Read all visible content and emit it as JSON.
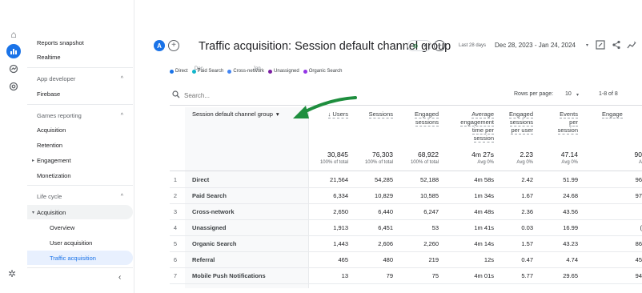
{
  "rail": {
    "icons": [
      "home-icon",
      "reports-icon",
      "explore-icon",
      "advertising-icon",
      "settings-icon"
    ]
  },
  "sidebar": {
    "reports_snapshot": "Reports snapshot",
    "realtime": "Realtime",
    "app_developer": "App developer",
    "firebase": "Firebase",
    "games_reporting": "Games reporting",
    "acquisition_games": "Acquisition",
    "retention": "Retention",
    "engagement": "Engagement",
    "monetization": "Monetization",
    "life_cycle": "Life cycle",
    "acquisition": "Acquisition",
    "overview": "Overview",
    "user_acquisition": "User acquisition",
    "traffic_acquisition": "Traffic acquisition",
    "collapse": "‹"
  },
  "header": {
    "badge": "A",
    "title": "Traffic acquisition: Session default channel group",
    "date_label": "Last 28 days",
    "date_range": "Dec 28, 2023 - Jan 24, 2024"
  },
  "chart_axis": {
    "tick1": "Dec",
    "tick2": "Jan"
  },
  "legend": [
    {
      "label": "Direct",
      "color": "#1a73e8"
    },
    {
      "label": "Paid Search",
      "color": "#12b5cb"
    },
    {
      "label": "Cross-network",
      "color": "#4285f4"
    },
    {
      "label": "Unassigned",
      "color": "#7b1fa2"
    },
    {
      "label": "Organic Search",
      "color": "#9334e6"
    }
  ],
  "table_controls": {
    "search_placeholder": "Search...",
    "rows_per_page_label": "Rows per page:",
    "rows_per_page": "10",
    "pager": "1-8 of 8"
  },
  "table": {
    "dimension_header": "Session default channel group",
    "columns": {
      "users": "↓ Users",
      "sessions": "Sessions",
      "engaged_sessions": [
        "Engaged",
        "sessions"
      ],
      "avg_engagement": [
        "Average",
        "engagement",
        "time per",
        "session"
      ],
      "engaged_per_user": [
        "Engaged",
        "sessions",
        "per user"
      ],
      "events_per_session": [
        "Events",
        "per",
        "session"
      ],
      "engagement_rate": "Engage"
    },
    "totals": {
      "users": "30,845",
      "users_sub": "100% of total",
      "sessions": "76,303",
      "sessions_sub": "100% of total",
      "engaged_sessions": "68,922",
      "engaged_sessions_sub": "100% of total",
      "avg_engagement": "4m 27s",
      "avg_engagement_sub": "Avg 0%",
      "engaged_per_user": "2.23",
      "engaged_per_user_sub": "Avg 0%",
      "events_per_session": "47.14",
      "events_per_session_sub": "Avg 0%",
      "engagement_rate": "90",
      "engagement_rate_sub": "A"
    },
    "rows": [
      {
        "idx": "1",
        "channel": "Direct",
        "users": "21,564",
        "sessions": "54,285",
        "engaged": "52,188",
        "avg": "4m 58s",
        "per_user": "2.42",
        "events": "51.99",
        "rate": "96"
      },
      {
        "idx": "2",
        "channel": "Paid Search",
        "users": "6,334",
        "sessions": "10,829",
        "engaged": "10,585",
        "avg": "1m 34s",
        "per_user": "1.67",
        "events": "24.68",
        "rate": "97"
      },
      {
        "idx": "3",
        "channel": "Cross-network",
        "users": "2,650",
        "sessions": "6,440",
        "engaged": "6,247",
        "avg": "4m 48s",
        "per_user": "2.36",
        "events": "43.56",
        "rate": ""
      },
      {
        "idx": "4",
        "channel": "Unassigned",
        "users": "1,913",
        "sessions": "6,451",
        "engaged": "53",
        "avg": "1m 41s",
        "per_user": "0.03",
        "events": "16.99",
        "rate": "("
      },
      {
        "idx": "5",
        "channel": "Organic Search",
        "users": "1,443",
        "sessions": "2,606",
        "engaged": "2,260",
        "avg": "4m 14s",
        "per_user": "1.57",
        "events": "43.23",
        "rate": "86"
      },
      {
        "idx": "6",
        "channel": "Referral",
        "users": "465",
        "sessions": "480",
        "engaged": "219",
        "avg": "12s",
        "per_user": "0.47",
        "events": "4.74",
        "rate": "45"
      },
      {
        "idx": "7",
        "channel": "Mobile Push Notifications",
        "users": "13",
        "sessions": "79",
        "engaged": "75",
        "avg": "4m 01s",
        "per_user": "5.77",
        "events": "29.65",
        "rate": "94"
      }
    ]
  },
  "colors": {
    "accent": "#1a73e8",
    "arrow": "#1e8e3e"
  }
}
